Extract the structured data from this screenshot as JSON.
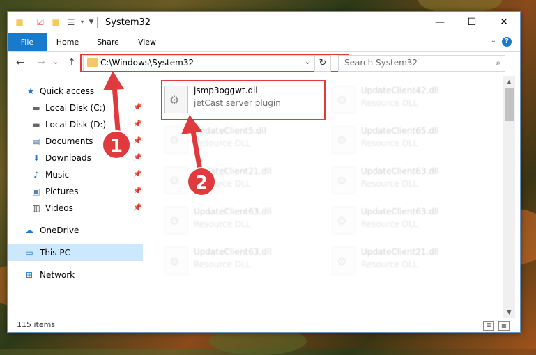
{
  "window": {
    "title": "System32",
    "minimize": "—",
    "maximize": "☐",
    "close": "✕"
  },
  "ribbon": {
    "tabs": [
      "File",
      "Home",
      "Share",
      "View"
    ],
    "help": "?"
  },
  "navigation": {
    "back": "←",
    "forward": "→",
    "dropdown": "⌄",
    "up": "↑",
    "address": "C:\\Windows\\System32",
    "refresh": "↻",
    "search_placeholder": "Search System32"
  },
  "nav_pane": {
    "items": [
      {
        "label": "Quick access",
        "icon": "star-icon"
      },
      {
        "label": "Local Disk (C:)",
        "icon": "drive-icon",
        "pinned": true
      },
      {
        "label": "Local Disk (D:)",
        "icon": "drive-icon",
        "pinned": true
      },
      {
        "label": "Documents",
        "icon": "documents-icon",
        "pinned": true
      },
      {
        "label": "Downloads",
        "icon": "download-icon",
        "pinned": true
      },
      {
        "label": "Music",
        "icon": "music-icon",
        "pinned": true
      },
      {
        "label": "Pictures",
        "icon": "pictures-icon",
        "pinned": true
      },
      {
        "label": "Videos",
        "icon": "videos-icon",
        "pinned": true
      },
      {
        "label": "OneDrive",
        "icon": "cloud-icon"
      },
      {
        "label": "This PC",
        "icon": "computer-icon",
        "selected": true
      },
      {
        "label": "Network",
        "icon": "network-icon"
      }
    ]
  },
  "files": [
    {
      "name": "jsmp3oggwt.dll",
      "type": "jetCast server plugin",
      "highlighted": true
    },
    {
      "name": "UpdateClient42.dll",
      "type": "Resource DLL"
    },
    {
      "name": "UpdateClient5.dll",
      "type": "Resource DLL"
    },
    {
      "name": "UpdateClient65.dll",
      "type": "Resource DLL"
    },
    {
      "name": "UpdateClient21.dll",
      "type": "Resource DLL"
    },
    {
      "name": "UpdateClient63.dll",
      "type": "Resource DLL"
    },
    {
      "name": "UpdateClient63.dll",
      "type": "Resource DLL"
    },
    {
      "name": "UpdateClient63.dll",
      "type": "Resource DLL"
    },
    {
      "name": "UpdateClient63.dll",
      "type": "Resource DLL"
    },
    {
      "name": "UpdateClient21.dll",
      "type": "Resource DLL"
    }
  ],
  "status": {
    "item_count": "115 items"
  },
  "annotations": {
    "step1": "1",
    "step2": "2",
    "color": "#e0393e"
  }
}
